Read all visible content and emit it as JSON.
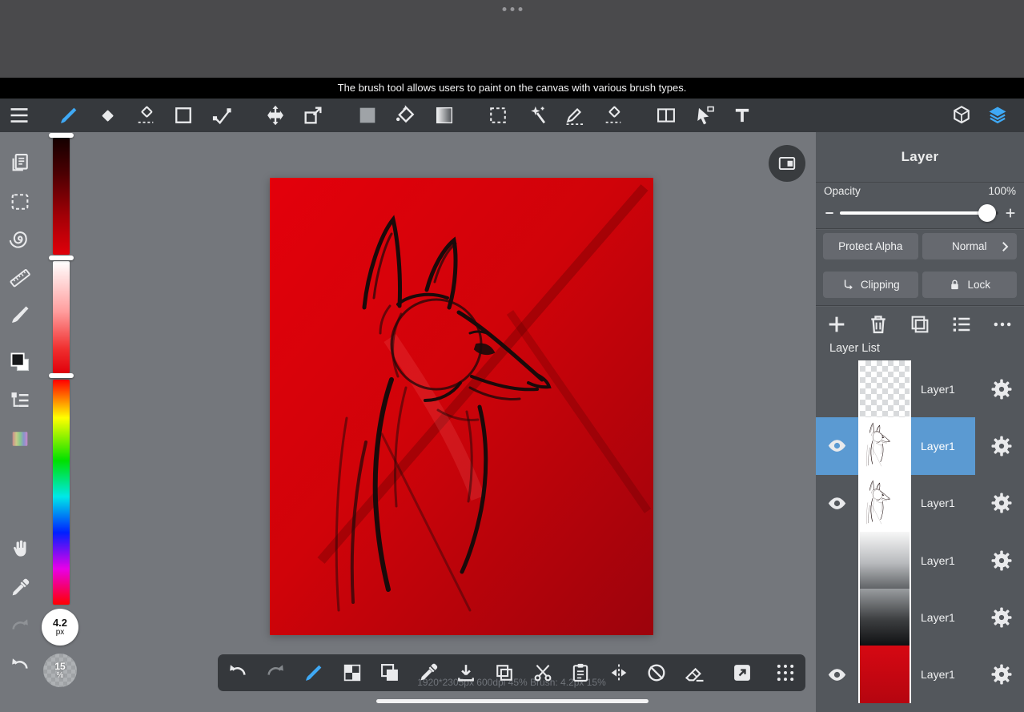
{
  "notice": {
    "text": "The brush tool allows users to paint on the canvas with various brush types."
  },
  "left_rail": {
    "brush_size": {
      "value": "4.2",
      "unit": "px"
    },
    "brush_opacity": {
      "value": "15",
      "unit": "%"
    }
  },
  "status_bar": {
    "text": "1920*2305px 600dpi 45% Brush: 4.2px 15%"
  },
  "layer_panel": {
    "title": "Layer",
    "opacity_label": "Opacity",
    "opacity_value": "100%",
    "protect_alpha_label": "Protect Alpha",
    "blend_mode_label": "Normal",
    "clipping_label": "Clipping",
    "lock_label": "Lock",
    "list_title": "Layer List",
    "layers": [
      {
        "name": "Layer1",
        "thumb": "checker",
        "visible": false,
        "selected": false
      },
      {
        "name": "Layer1",
        "thumb": "sketch",
        "visible": true,
        "selected": true
      },
      {
        "name": "Layer1",
        "thumb": "sketch",
        "visible": true,
        "selected": false
      },
      {
        "name": "Layer1",
        "thumb": "gradient-light",
        "visible": false,
        "selected": false
      },
      {
        "name": "Layer1",
        "thumb": "gradient-dark",
        "visible": false,
        "selected": false
      },
      {
        "name": "Layer1",
        "thumb": "red",
        "visible": true,
        "selected": false
      }
    ]
  },
  "icons": {
    "top_toolbar": [
      "menu",
      "brush",
      "eraser",
      "select-eraser",
      "shape-rect",
      "polyline",
      "move",
      "transform",
      "fill-shape",
      "paint-bucket",
      "gradient",
      "select-rect",
      "magic-wand",
      "select-pen",
      "select-erase",
      "divide-canvas",
      "select-cursor",
      "text",
      "material-3d",
      "layers"
    ],
    "bottom_toolbar": [
      "undo",
      "redo",
      "brush",
      "transparent-background",
      "merge-layer",
      "eyedropper",
      "save",
      "copy",
      "cut",
      "paste",
      "flip-horizontal",
      "rotate-lock",
      "clear",
      "material",
      "grid"
    ],
    "panel_row": [
      "add-layer",
      "delete-layer",
      "duplicate-layer",
      "layer-menu",
      "more"
    ]
  },
  "colors": {
    "accent_blue": "#3fa9f5",
    "selected_layer_blue": "#5b9ad2",
    "canvas_red_top": "#e3000b",
    "canvas_red_bottom": "#9c030c"
  }
}
